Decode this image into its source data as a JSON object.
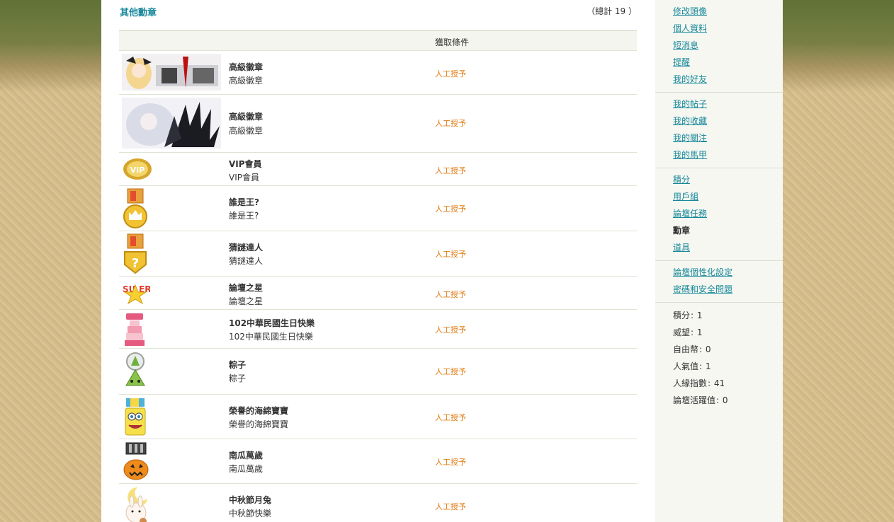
{
  "main": {
    "section_title": "其他勳章",
    "total": "（總計 19 ）",
    "table_header_condition": "獲取條件"
  },
  "medals": [
    {
      "name": "高級徽章",
      "desc": "高級徽章",
      "condition": "人工授予",
      "icon": "anime-banner-medal-icon"
    },
    {
      "name": "高級徽章",
      "desc": "高級徽章",
      "condition": "人工授予",
      "icon": "dark-angel-medal-icon"
    },
    {
      "name": "VIP會員",
      "desc": "VIP會員",
      "condition": "人工授予",
      "icon": "vip-medal-icon"
    },
    {
      "name": "誰是王?",
      "desc": "誰是王?",
      "condition": "人工授予",
      "icon": "crown-medal-icon"
    },
    {
      "name": "猜謎達人",
      "desc": "猜謎達人",
      "condition": "人工授予",
      "icon": "question-medal-icon"
    },
    {
      "name": "論壇之星",
      "desc": "論壇之星",
      "condition": "人工授予",
      "icon": "super-star-icon"
    },
    {
      "name": "102中華民國生日快樂",
      "desc": "102中華民國生日快樂",
      "condition": "人工授予",
      "icon": "birthday-cake-icon"
    },
    {
      "name": "粽子",
      "desc": "粽子",
      "condition": "人工授予",
      "icon": "zongzi-icon"
    },
    {
      "name": "榮譽的海綿寶寶",
      "desc": "榮譽的海綿寶寶",
      "condition": "人工授予",
      "icon": "spongebob-icon"
    },
    {
      "name": "南瓜萬歲",
      "desc": "南瓜萬歲",
      "condition": "人工授予",
      "icon": "pumpkin-icon"
    },
    {
      "name": "中秋節月兔",
      "desc": "中秋節快樂",
      "condition": "人工授予",
      "icon": "moon-rabbit-icon"
    }
  ],
  "sidebar": {
    "group1": [
      "修改頭像",
      "個人資料",
      "短消息",
      "提醒",
      "我的好友"
    ],
    "group2": [
      "我的帖子",
      "我的收藏",
      "我的關注",
      "我的馬甲"
    ],
    "group3": [
      "積分",
      "用戶組",
      "論壇任務",
      "勳章",
      "道具"
    ],
    "group3_active": "勳章",
    "group4": [
      "論壇個性化設定",
      "密碼和安全問題"
    ],
    "stats": [
      {
        "label": "積分",
        "value": "1"
      },
      {
        "label": "威望",
        "value": "1"
      },
      {
        "label": "自由幣",
        "value": "0"
      },
      {
        "label": "人氣值",
        "value": "1"
      },
      {
        "label": "人緣指數",
        "value": "41"
      },
      {
        "label": "論壇活躍值",
        "value": "0"
      }
    ]
  },
  "colors": {
    "link": "#17889a",
    "condition": "#e07a10",
    "sidebar_bg": "#f6f7f1"
  }
}
